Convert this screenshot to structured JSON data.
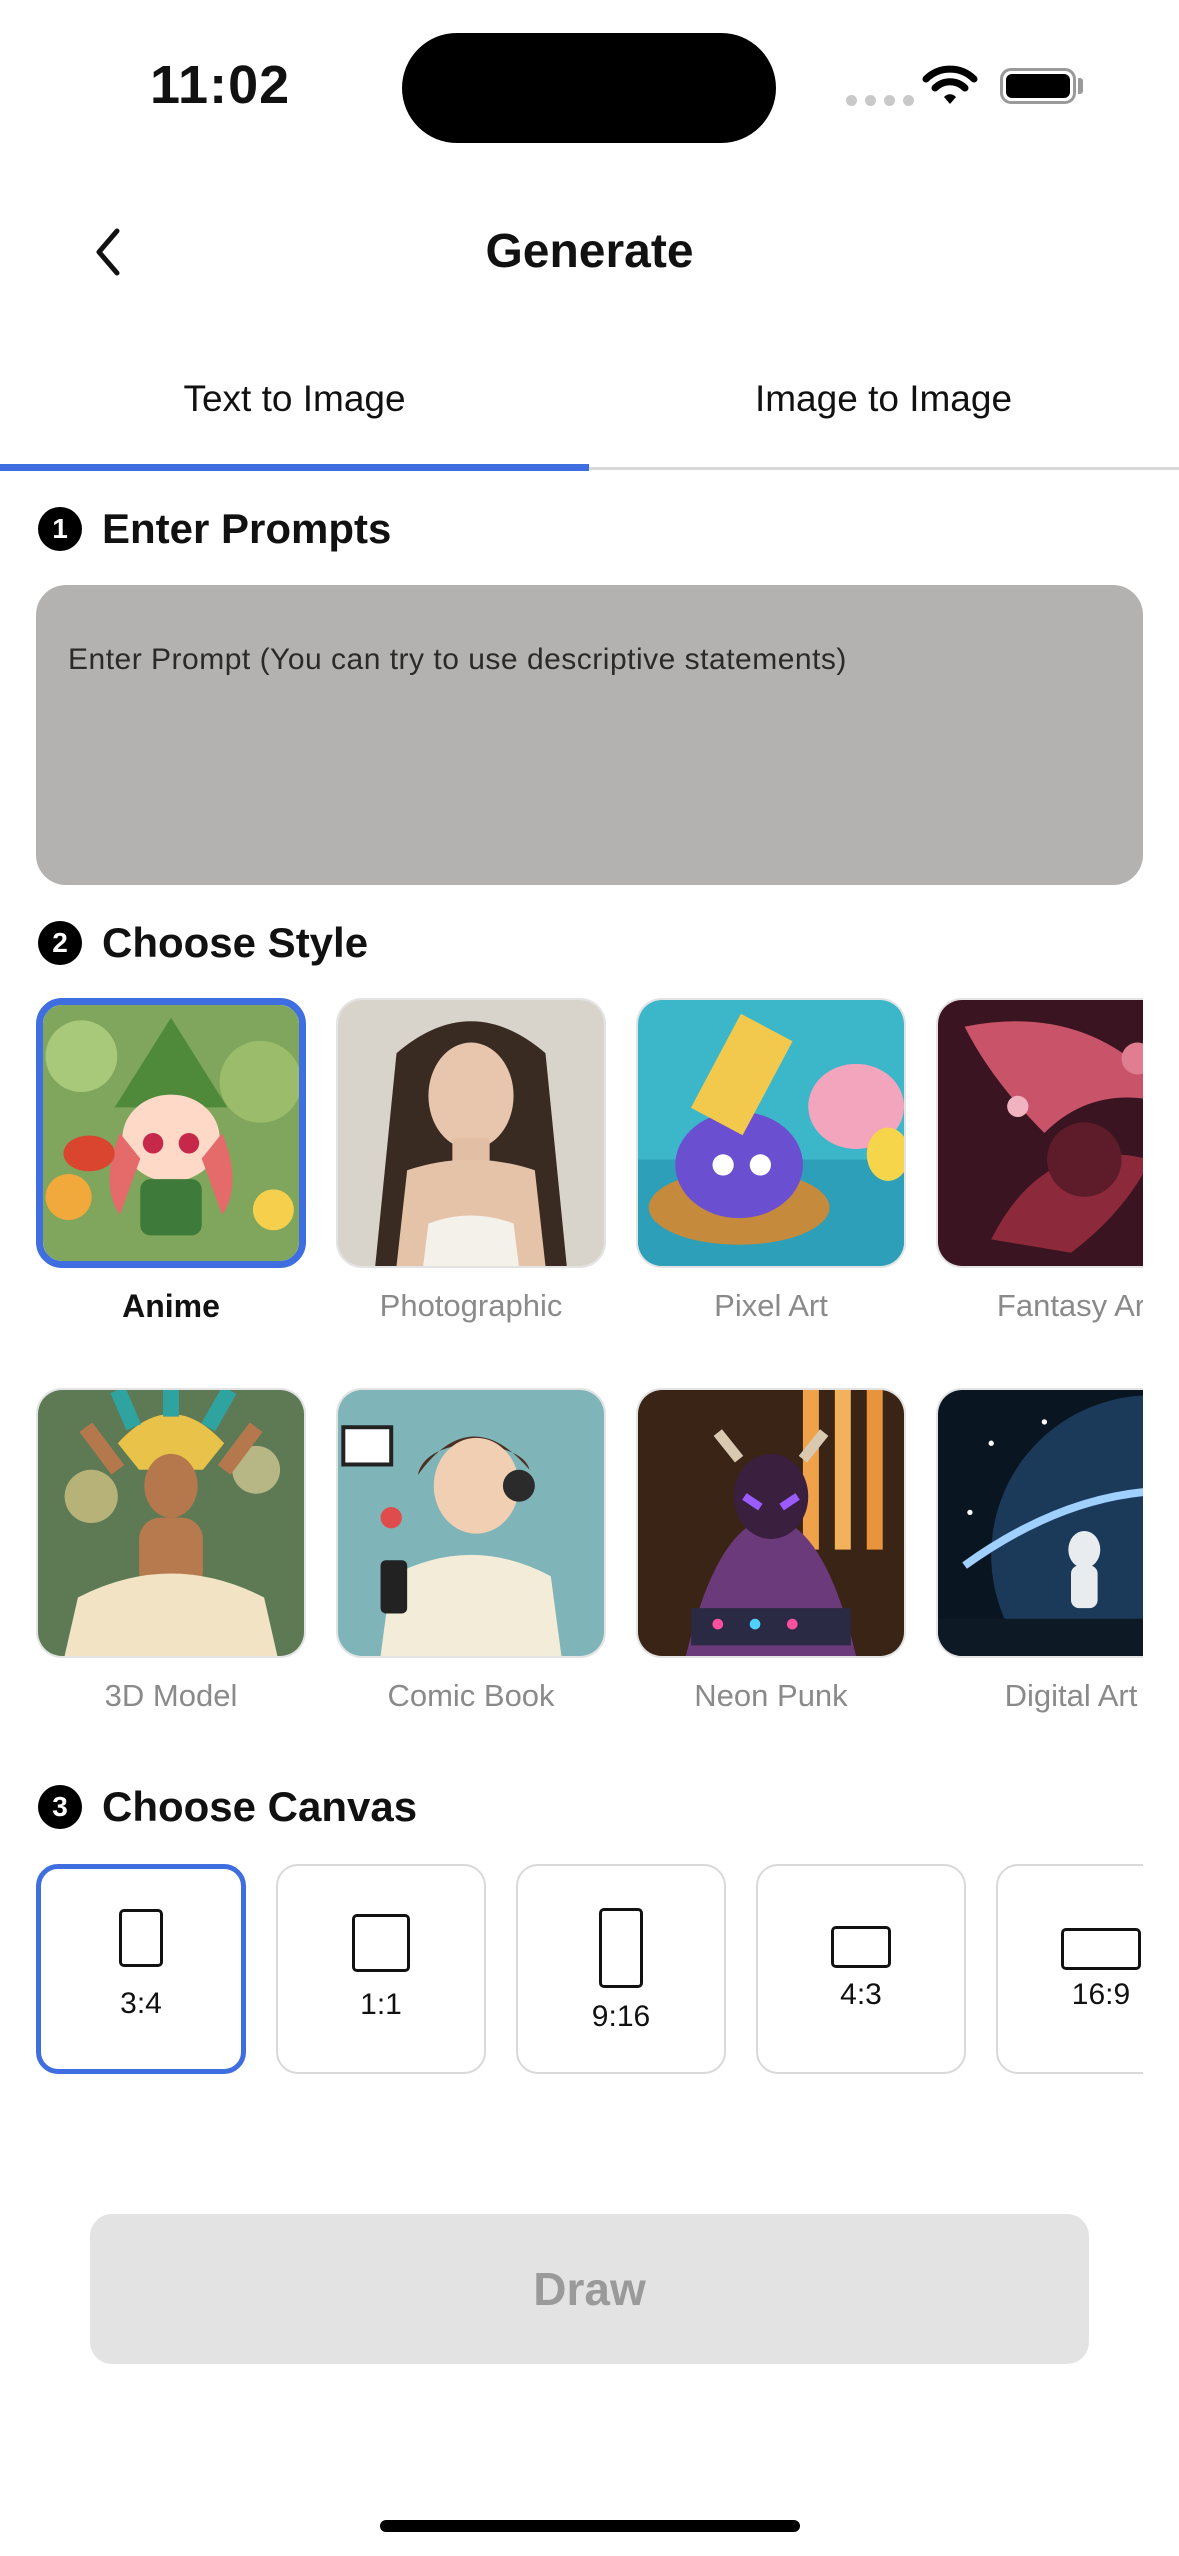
{
  "status_bar": {
    "time": "11:02"
  },
  "header": {
    "title": "Generate"
  },
  "tabs": [
    {
      "label": "Text to Image",
      "active": true
    },
    {
      "label": "Image to Image",
      "active": false
    }
  ],
  "sections": {
    "prompts": {
      "number": "1",
      "title": "Enter Prompts"
    },
    "style": {
      "number": "2",
      "title": "Choose Style"
    },
    "canvas": {
      "number": "3",
      "title": "Choose Canvas"
    }
  },
  "prompt": {
    "placeholder": "Enter Prompt (You can try to use descriptive statements)",
    "value": ""
  },
  "styles": [
    {
      "label": "Anime",
      "selected": true
    },
    {
      "label": "Photographic",
      "selected": false
    },
    {
      "label": "Pixel Art",
      "selected": false
    },
    {
      "label": "Fantasy Ar",
      "selected": false
    },
    {
      "label": "3D Model",
      "selected": false
    },
    {
      "label": "Comic Book",
      "selected": false
    },
    {
      "label": "Neon Punk",
      "selected": false
    },
    {
      "label": "Digital Art",
      "selected": false
    }
  ],
  "canvases": [
    {
      "label": "3:4",
      "selected": true
    },
    {
      "label": "1:1",
      "selected": false
    },
    {
      "label": "9:16",
      "selected": false
    },
    {
      "label": "4:3",
      "selected": false
    },
    {
      "label": "16:9",
      "selected": false
    }
  ],
  "draw_button": {
    "label": "Draw",
    "enabled": false
  },
  "colors": {
    "accent": "#3f6ee0",
    "prompt_bg": "#b4b2b0",
    "draw_bg": "#e3e3e3",
    "muted_text": "#8a8a8a"
  }
}
